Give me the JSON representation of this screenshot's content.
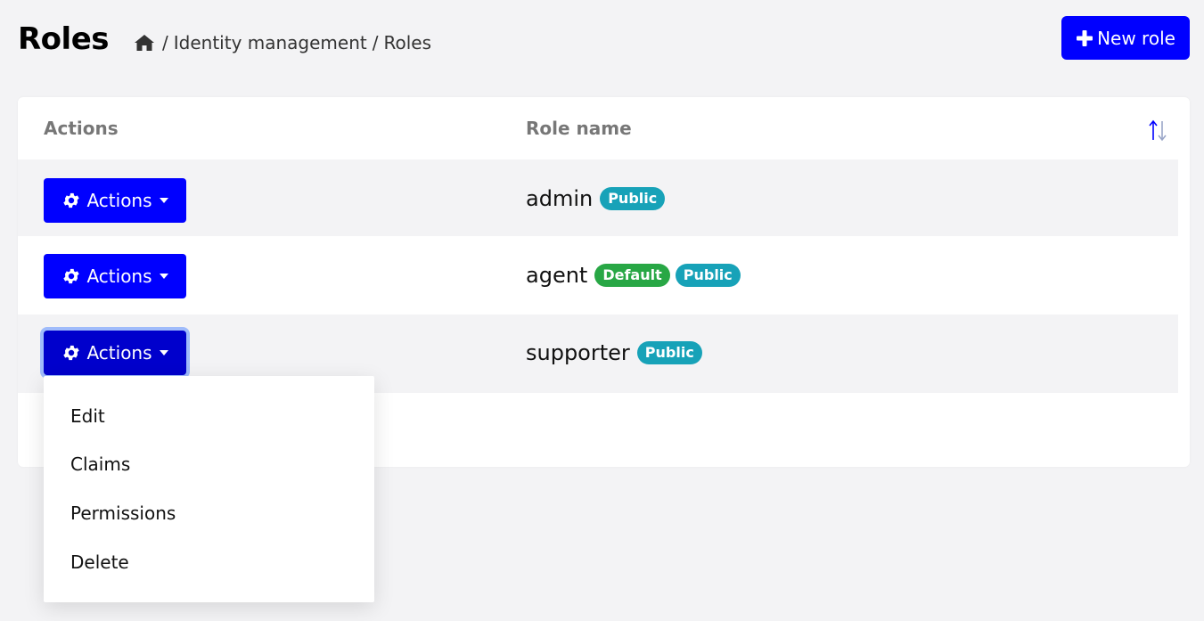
{
  "header": {
    "title": "Roles",
    "breadcrumb": [
      "Identity management",
      "Roles"
    ],
    "breadcrumb_separator": "/",
    "new_role_label": "New role"
  },
  "table": {
    "columns": [
      "Actions",
      "Role name"
    ],
    "rows": [
      {
        "action_label": "Actions",
        "name": "admin",
        "badges": [
          "Public"
        ]
      },
      {
        "action_label": "Actions",
        "name": "agent",
        "badges": [
          "Default",
          "Public"
        ]
      },
      {
        "action_label": "Actions",
        "name": "supporter",
        "badges": [
          "Public"
        ]
      }
    ]
  },
  "dropdown": {
    "items": [
      "Edit",
      "Claims",
      "Permissions",
      "Delete"
    ]
  },
  "colors": {
    "primary": "#0000ff",
    "badge_public": "#17a2b8",
    "badge_default": "#28a745",
    "page_bg": "#f3f3f5"
  },
  "icons": [
    "home-icon",
    "plus-icon",
    "sort-icon",
    "gear-icon",
    "caret-down-icon"
  ]
}
